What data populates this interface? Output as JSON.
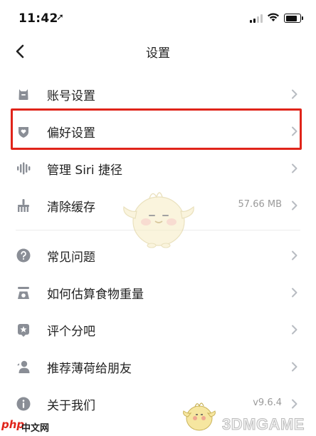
{
  "status_bar": {
    "time": "11:42",
    "location_glyph": "➚"
  },
  "nav": {
    "title": "设置"
  },
  "rows": [
    {
      "label": "账号设置",
      "icon": "account-icon",
      "value": ""
    },
    {
      "label": "偏好设置",
      "icon": "preference-icon",
      "value": ""
    },
    {
      "label": "管理 Siri 捷径",
      "icon": "siri-icon",
      "value": ""
    },
    {
      "label": "清除缓存",
      "icon": "broom-icon",
      "value": "57.66 MB"
    },
    {
      "label": "常见问题",
      "icon": "question-icon",
      "value": ""
    },
    {
      "label": "如何估算食物重量",
      "icon": "scale-icon",
      "value": ""
    },
    {
      "label": "评个分吧",
      "icon": "rate-icon",
      "value": ""
    },
    {
      "label": "推荐薄荷给朋友",
      "icon": "recommend-icon",
      "value": ""
    },
    {
      "label": "关于我们",
      "icon": "info-icon",
      "value": "v9.6.4"
    }
  ],
  "watermarks": {
    "php": "php",
    "php_cn": "中文网",
    "game": "3DMGAME"
  },
  "colors": {
    "highlight": "#e0241a",
    "icon": "#8a8e96",
    "chevron": "#b8bcc2"
  }
}
